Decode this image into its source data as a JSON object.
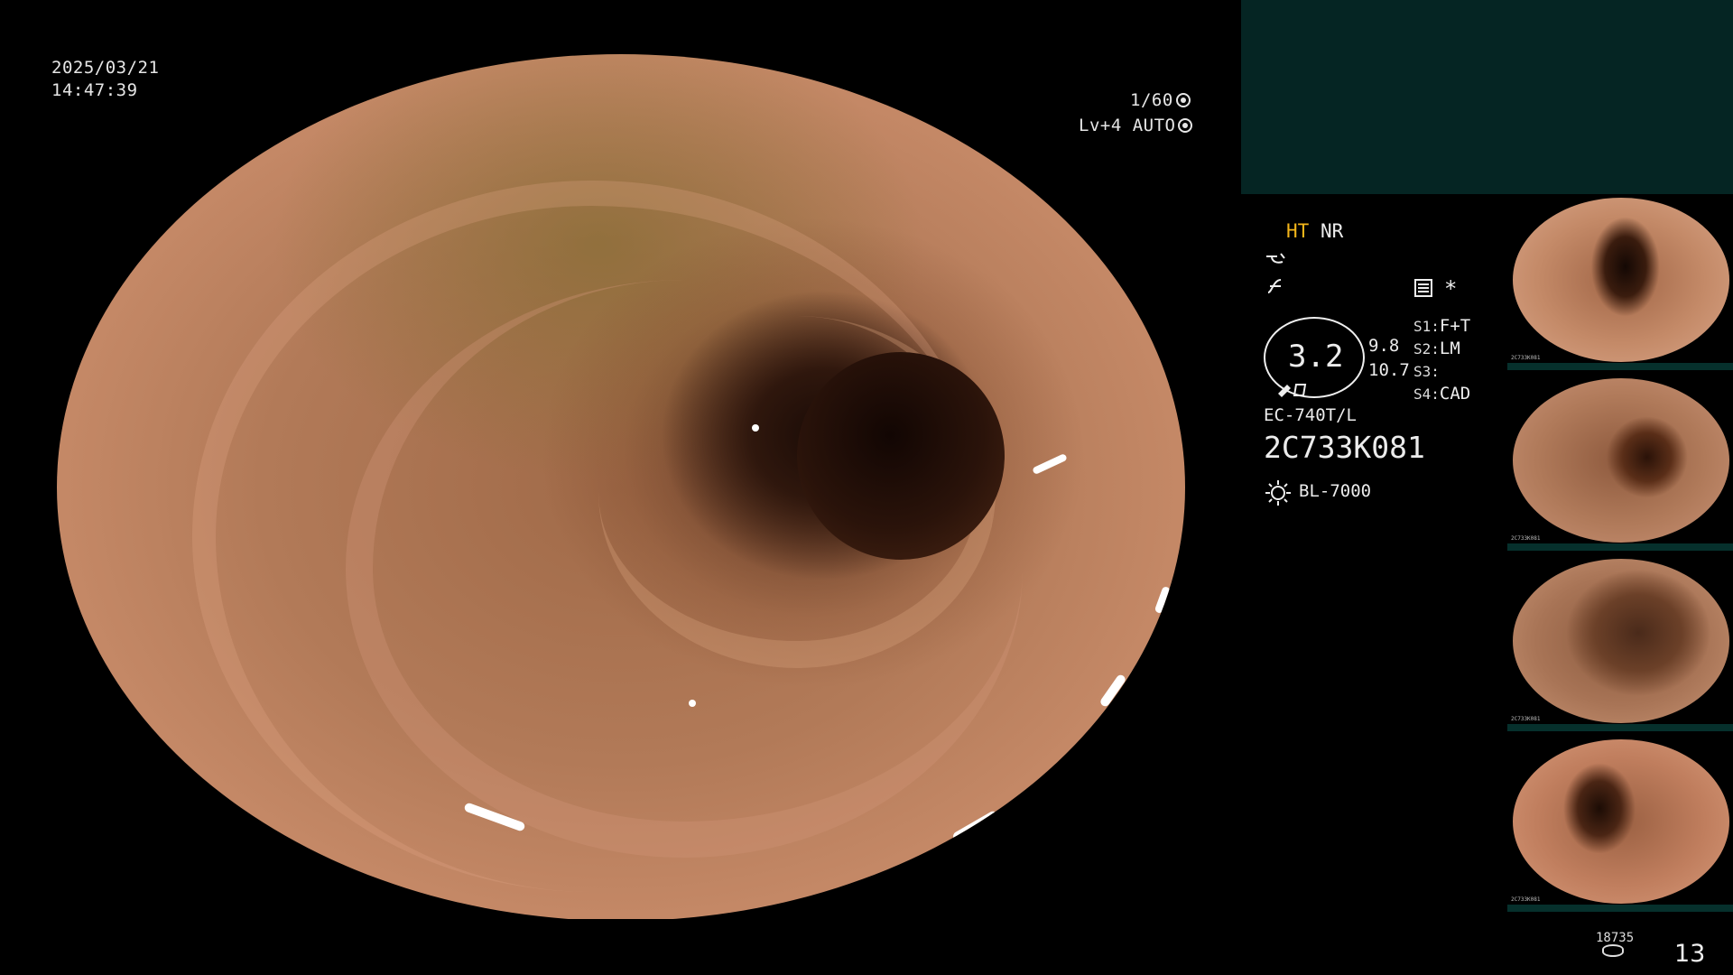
{
  "overlay": {
    "date": "2025/03/21",
    "time": "14:47:39",
    "shutter": "1/60",
    "level": "Lv+4",
    "mode": "AUTO"
  },
  "icons": {
    "shutter": "aperture-icon",
    "mode": "iris-icon",
    "enhance1": "squiggle-icon",
    "enhance2": "f-curve-icon",
    "settings": "settings-panel-icon",
    "asterisk": "asterisk-icon",
    "light": "sun-icon",
    "counter": "disk-icon"
  },
  "status": {
    "ht": "HT",
    "nr": "NR",
    "asterisk": "*",
    "brightness": "3.2",
    "sub_value_1": "9.8",
    "sub_value_2": "10.7",
    "scope_model": "EC-740T/L",
    "serial": "2C733K081",
    "light_source": "BL-7000",
    "switches": [
      {
        "label": "S1:",
        "value": "F+T"
      },
      {
        "label": "S2:",
        "value": "LM"
      },
      {
        "label": "S3:",
        "value": ""
      },
      {
        "label": "S4:",
        "value": "CAD"
      }
    ]
  },
  "thumbnails": [
    {
      "meta": "2C733K081"
    },
    {
      "meta": "2C733K081"
    },
    {
      "meta": "2C733K081"
    },
    {
      "meta": "2C733K081"
    }
  ],
  "footer": {
    "storage_count": "18735",
    "frame_number": "13"
  },
  "colors": {
    "accent_ht": "#f3b51a",
    "top_panel": "#052523"
  }
}
